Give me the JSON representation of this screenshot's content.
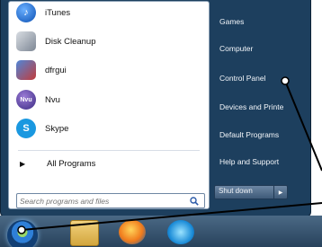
{
  "start_menu": {
    "pinned_programs": [
      {
        "label": "iTunes",
        "icon": "itunes-icon"
      },
      {
        "label": "Disk Cleanup",
        "icon": "disk-cleanup-icon"
      },
      {
        "label": "dfrgui",
        "icon": "dfrgui-icon"
      },
      {
        "label": "Nvu",
        "icon": "nvu-icon"
      },
      {
        "label": "Skype",
        "icon": "skype-icon"
      }
    ],
    "all_programs_label": "All Programs",
    "search_placeholder": "Search programs and files",
    "right_items": [
      "Games",
      "Computer",
      "Control Panel",
      "Devices and Printe",
      "Default Programs",
      "Help and Support"
    ],
    "shutdown_label": "Shut down"
  },
  "taskbar": {
    "icons": [
      "start-orb-icon",
      "folder-icon",
      "firefox-icon",
      "internet-explorer-icon"
    ]
  },
  "icon_glyphs": {
    "itunes": "♪",
    "disk": "",
    "dfrgui": "",
    "nvu": "Nvu",
    "skype": "S"
  },
  "colors": {
    "menu_dark": "#1d3f5e",
    "panel_white": "#ffffff",
    "taskbar": "#28425c"
  }
}
